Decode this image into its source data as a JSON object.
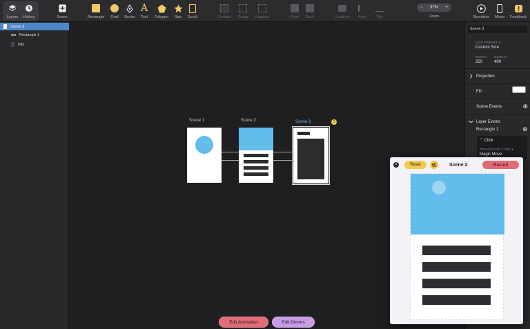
{
  "toolbar": {
    "layers": "Layers",
    "history": "History",
    "scene": "Scene",
    "rectangle": "Rectangle",
    "oval": "Oval",
    "bezier": "Bezier",
    "text": "Text",
    "polygon": "Polygon",
    "star": "Star",
    "scroll": "Scroll",
    "embed": "Embed",
    "group": "Group",
    "ungroup": "Ungroup",
    "front": "Front",
    "back": "Back",
    "combine": "Combine",
    "align": "Align",
    "flip": "Flip",
    "zoom_value": "37%",
    "zoom_minus": "−",
    "zoom_plus": "+",
    "zoom_label": "Zoom",
    "simulator": "Simulator",
    "mirror": "Mirror",
    "feedback": "Feedback"
  },
  "layers_panel": {
    "items": [
      {
        "label": "Scene 3"
      },
      {
        "label": "Rectangle 1"
      },
      {
        "label": "Info"
      }
    ]
  },
  "canvas": {
    "scenes": [
      {
        "title": "Scene 1"
      },
      {
        "title": "Scene 2"
      },
      {
        "title": "Scene 3"
      }
    ],
    "warning_badge": "!",
    "buttons": {
      "edit_animation": "Edit Animation",
      "edit_drivers": "Edit Drivers"
    }
  },
  "inspector": {
    "name": "Scene 3",
    "size_preset_label": "SIZE PRESET ▾",
    "size_preset_value": "Custom Size",
    "width_label": "WIDTH",
    "width_value": "250",
    "height_label": "HEIGHT",
    "height_value": "400",
    "projection": "Projection",
    "fill": "Fill",
    "scene_events": "Scene Events",
    "layer_events": "Layer Events",
    "layer_event_target": "Rectangle 1",
    "event_trigger": "⌃ Click",
    "transition_type_label": "TRANSITION TYPE ▾",
    "transition_type_value": "Magic Move"
  },
  "preview": {
    "close": "×",
    "reset": "Reset",
    "title": "Scene 2",
    "record": "Record"
  },
  "colors": {
    "accent_blue": "#4f86c6",
    "scene_blue": "#62bdec",
    "reset_yellow": "#f2c94c",
    "record_red": "#e06a78",
    "edit_animation": "#e36b78",
    "edit_drivers": "#c79be6"
  }
}
